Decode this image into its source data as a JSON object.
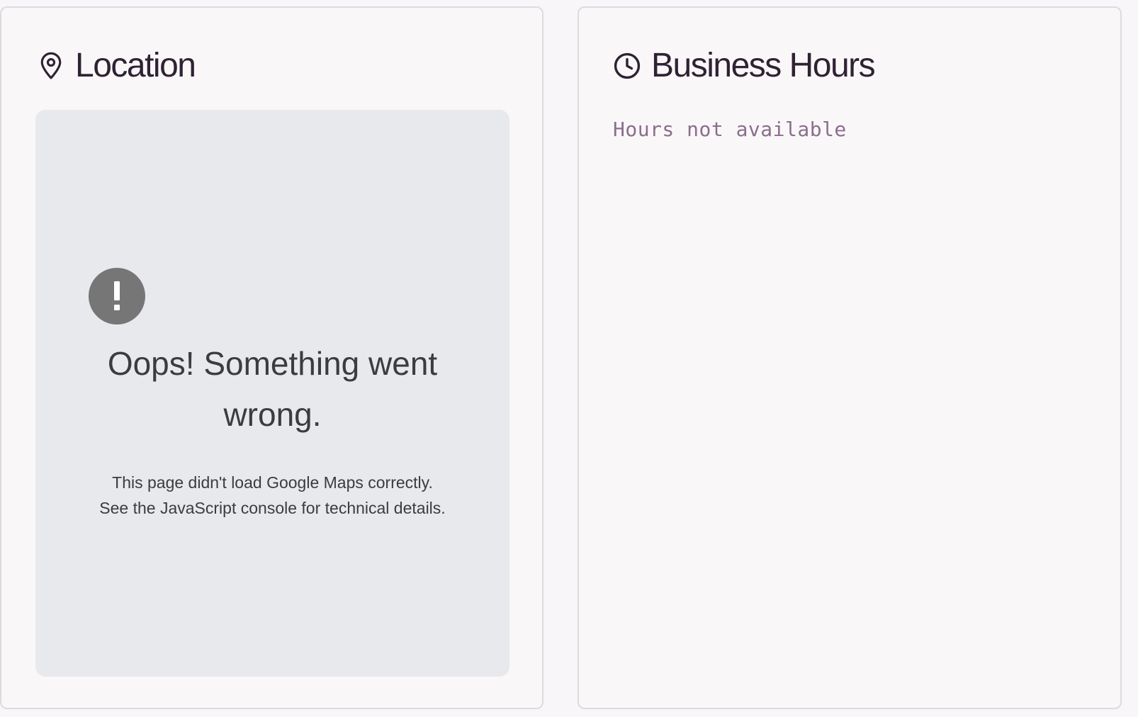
{
  "location_card": {
    "title": "Location",
    "icon": "map-pin-icon",
    "map_error": {
      "icon": "exclamation-icon",
      "heading": "Oops! Something went wrong.",
      "line1": "This page didn't load Google Maps correctly.",
      "line2": "See the JavaScript console for technical details."
    }
  },
  "hours_card": {
    "title": "Business Hours",
    "icon": "clock-icon",
    "status": "Hours not available"
  },
  "colors": {
    "title": "#2f2232",
    "muted_mono": "#8b6e8d",
    "map_bg": "#e8e9ec",
    "error_badge": "#767676"
  }
}
